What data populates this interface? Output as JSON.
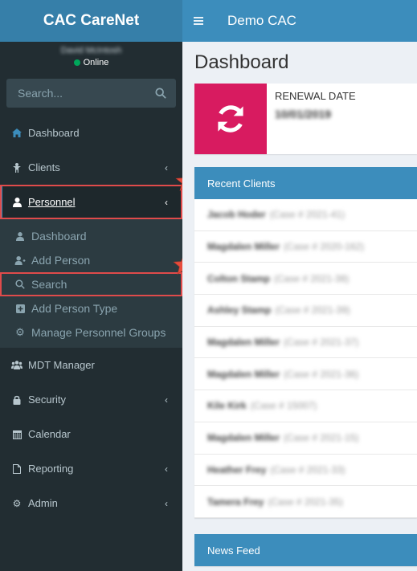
{
  "brand": {
    "title": "CAC CareNet"
  },
  "user": {
    "name": "David McIntosh",
    "status": "Online"
  },
  "sidebar_search": {
    "placeholder": "Search..."
  },
  "menu": {
    "dashboard": "Dashboard",
    "clients": "Clients",
    "personnel": "Personnel",
    "personnel_sub": {
      "dashboard": "Dashboard",
      "add_person": "Add Person",
      "search": "Search",
      "add_person_type": "Add Person Type",
      "manage_groups": "Manage Personnel Groups"
    },
    "mdt_manager": "MDT Manager",
    "security": "Security",
    "calendar": "Calendar",
    "reporting": "Reporting",
    "admin": "Admin"
  },
  "header": {
    "title": "Demo CAC"
  },
  "page": {
    "title": "Dashboard"
  },
  "renewal": {
    "label": "RENEWAL DATE",
    "date": "10/01/2019"
  },
  "recent_clients": {
    "title": "Recent Clients",
    "rows": [
      {
        "name": "Jacob Hoder",
        "case": "(Case # 2021-41)"
      },
      {
        "name": "Magdalen Miller",
        "case": "(Case # 2020-162)"
      },
      {
        "name": "Colton Stamp",
        "case": "(Case # 2021-38)"
      },
      {
        "name": "Ashley Stamp",
        "case": "(Case # 2021-39)"
      },
      {
        "name": "Magdalen Miller",
        "case": "(Case # 2021-37)"
      },
      {
        "name": "Magdalen Miller",
        "case": "(Case # 2021-36)"
      },
      {
        "name": "Kile Kirk",
        "case": "(Case # 15007)"
      },
      {
        "name": "Magdalen Miller",
        "case": "(Case # 2021-15)"
      },
      {
        "name": "Heather Frey",
        "case": "(Case # 2021-33)"
      },
      {
        "name": "Tamera Frey",
        "case": "(Case # 2021-35)"
      }
    ]
  },
  "news_feed": {
    "title": "News Feed"
  },
  "colors": {
    "brand": "#367fa9",
    "header": "#3c8dbc",
    "sidebar": "#222d32",
    "renewal_icon": "#d81b60",
    "highlight": "#e04b4b"
  }
}
